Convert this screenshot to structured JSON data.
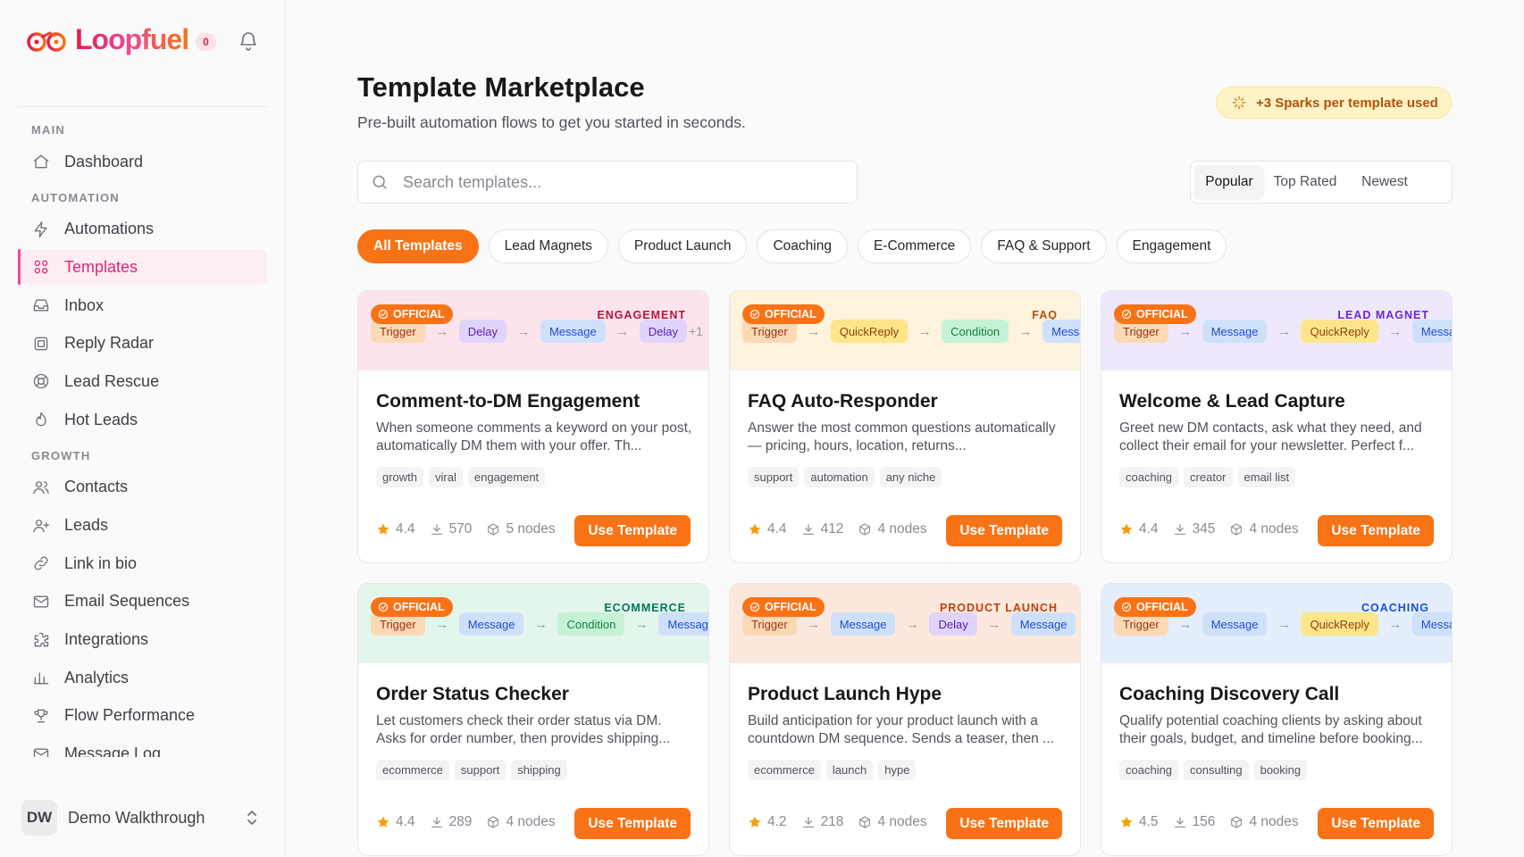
{
  "brand": {
    "name": "Loopfuel",
    "badge": "0"
  },
  "nav": {
    "sections": [
      {
        "label": "MAIN",
        "items": [
          {
            "label": "Dashboard",
            "icon": "home-icon"
          }
        ]
      },
      {
        "label": "AUTOMATION",
        "items": [
          {
            "label": "Automations",
            "icon": "bolt-icon"
          },
          {
            "label": "Templates",
            "icon": "grid-icon",
            "active": true
          },
          {
            "label": "Inbox",
            "icon": "inbox-icon"
          },
          {
            "label": "Reply Radar",
            "icon": "radar-icon"
          },
          {
            "label": "Lead Rescue",
            "icon": "lifebuoy-icon"
          },
          {
            "label": "Hot Leads",
            "icon": "flame-icon"
          }
        ]
      },
      {
        "label": "GROWTH",
        "items": [
          {
            "label": "Contacts",
            "icon": "users-icon"
          },
          {
            "label": "Leads",
            "icon": "user-plus-icon"
          },
          {
            "label": "Link in bio",
            "icon": "link-icon"
          },
          {
            "label": "Email Sequences",
            "icon": "mail-icon"
          },
          {
            "label": "Integrations",
            "icon": "puzzle-icon"
          },
          {
            "label": "Analytics",
            "icon": "bar-chart-icon"
          },
          {
            "label": "Flow Performance",
            "icon": "trophy-icon"
          },
          {
            "label": "Message Log",
            "icon": "mail-icon"
          }
        ]
      }
    ]
  },
  "user": {
    "initials": "DW",
    "name": "Demo Walkthrough"
  },
  "header": {
    "title": "Template Marketplace",
    "subtitle": "Pre-built automation flows to get you started in seconds.",
    "sparks": "+3 Sparks per template used"
  },
  "search": {
    "placeholder": "Search templates...",
    "value": ""
  },
  "sort": {
    "options": [
      "Popular",
      "Top Rated",
      "Newest"
    ],
    "active": "Popular"
  },
  "filters": {
    "options": [
      "All Templates",
      "Lead Magnets",
      "Product Launch",
      "Coaching",
      "E-Commerce",
      "FAQ & Support",
      "Engagement"
    ],
    "active": "All Templates"
  },
  "colors": {
    "accent": "#f97316",
    "brand_pink": "#ec4899",
    "star": "#f59e0b"
  },
  "card_common": {
    "official": "OFFICIAL",
    "cta": "Use Template"
  },
  "templates": [
    {
      "category": "ENGAGEMENT",
      "category_color": "#be123c",
      "head_bg": "#fde4ec",
      "flow": [
        "Trigger",
        "Delay",
        "Message",
        "Delay"
      ],
      "flow_more": "+1",
      "title": "Comment-to-DM Engagement",
      "description": "When someone comments a keyword on your post, automatically DM them with your offer. Th...",
      "tags": [
        "growth",
        "viral",
        "engagement"
      ],
      "rating": "4.4",
      "downloads": "570",
      "nodes": "5 nodes"
    },
    {
      "category": "FAQ",
      "category_color": "#b45309",
      "head_bg": "#fef3dc",
      "flow": [
        "Trigger",
        "QuickReply",
        "Condition",
        "Message"
      ],
      "flow_more": "",
      "title": "FAQ Auto-Responder",
      "description": "Answer the most common questions automatically — pricing, hours, location, returns...",
      "tags": [
        "support",
        "automation",
        "any niche"
      ],
      "rating": "4.4",
      "downloads": "412",
      "nodes": "4 nodes"
    },
    {
      "category": "LEAD MAGNET",
      "category_color": "#6d28d9",
      "head_bg": "#efe8fd",
      "flow": [
        "Trigger",
        "Message",
        "QuickReply",
        "Message"
      ],
      "flow_more": "",
      "title": "Welcome & Lead Capture",
      "description": "Greet new DM contacts, ask what they need, and collect their email for your newsletter. Perfect f...",
      "tags": [
        "coaching",
        "creator",
        "email list"
      ],
      "rating": "4.4",
      "downloads": "345",
      "nodes": "4 nodes"
    },
    {
      "category": "ECOMMERCE",
      "category_color": "#047857",
      "head_bg": "#e3f6ec",
      "flow": [
        "Trigger",
        "Message",
        "Condition",
        "Message"
      ],
      "flow_more": "",
      "title": "Order Status Checker",
      "description": "Let customers check their order status via DM. Asks for order number, then provides shipping...",
      "tags": [
        "ecommerce",
        "support",
        "shipping"
      ],
      "rating": "4.4",
      "downloads": "289",
      "nodes": "4 nodes"
    },
    {
      "category": "PRODUCT LAUNCH",
      "category_color": "#c2410c",
      "head_bg": "#fde8dd",
      "flow": [
        "Trigger",
        "Message",
        "Delay",
        "Message"
      ],
      "flow_more": "",
      "title": "Product Launch Hype",
      "description": "Build anticipation for your product launch with a countdown DM sequence. Sends a teaser, then ...",
      "tags": [
        "ecommerce",
        "launch",
        "hype"
      ],
      "rating": "4.2",
      "downloads": "218",
      "nodes": "4 nodes"
    },
    {
      "category": "COACHING",
      "category_color": "#1d4ed8",
      "head_bg": "#e4eefc",
      "flow": [
        "Trigger",
        "Message",
        "QuickReply",
        "Message"
      ],
      "flow_more": "",
      "title": "Coaching Discovery Call",
      "description": "Qualify potential coaching clients by asking about their goals, budget, and timeline before booking...",
      "tags": [
        "coaching",
        "consulting",
        "booking"
      ],
      "rating": "4.5",
      "downloads": "156",
      "nodes": "4 nodes"
    }
  ]
}
